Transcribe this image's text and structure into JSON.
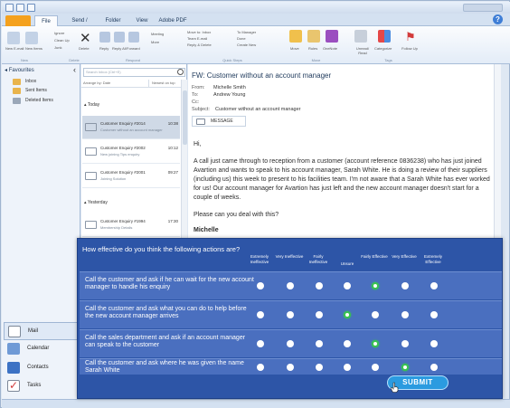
{
  "ribbon": {
    "tabs": [
      "File",
      "Send / Receive",
      "Folder",
      "View",
      "Adobe PDF"
    ],
    "groups": [
      "New",
      "Delete",
      "Respond",
      "Quick Steps",
      "Move",
      "Tags"
    ],
    "buttons": {
      "new_email": "New E-mail",
      "new_items": "New Items",
      "ignore": "Ignore",
      "clean_up": "Clean Up",
      "junk": "Junk",
      "delete": "Delete",
      "reply": "Reply",
      "reply_all": "Reply All",
      "forward": "Forward",
      "meeting": "Meeting",
      "more": "More",
      "move_to_inbox": "Move to: Inbox",
      "team_email": "Team E-mail",
      "reply_delete": "Reply & Delete",
      "to_manager": "To Manager",
      "done": "Done",
      "create_new": "Create New",
      "move": "Move",
      "rules": "Rules",
      "onenote": "OneNote",
      "unread_read": "Unread/ Read",
      "categorize": "Categorize",
      "follow_up": "Follow Up"
    }
  },
  "nav": {
    "header": "Favourites",
    "folders": [
      "Inbox",
      "Sent Items",
      "Deleted Items"
    ],
    "buttons": [
      "Mail",
      "Calendar",
      "Contacts",
      "Tasks"
    ]
  },
  "list": {
    "search_placeholder": "Search Inbox (Ctrl+E)",
    "arrange_by": "Arrange by: Date",
    "arrange_order": "Newest on top",
    "groups": [
      "Today",
      "Yesterday"
    ],
    "messages_today": [
      {
        "subject": "Customer Enquiry #2014",
        "preview": "Customer without an account manager",
        "time": "10:38"
      },
      {
        "subject": "Customer Enquiry #2002",
        "preview": "New joining Tips enquiry",
        "time": "10:12"
      },
      {
        "subject": "Customer Enquiry #2001",
        "preview": "Joining Solution",
        "time": "09:27"
      }
    ],
    "messages_yesterday": [
      {
        "subject": "Customer Enquiry #1994",
        "preview": "Membership Details",
        "time": "17:30"
      }
    ]
  },
  "reading": {
    "subject": "FW: Customer without an account manager",
    "from_label": "From:",
    "from": "Michelle Smith",
    "to_label": "To:",
    "to": "Andrew Young",
    "cc_label": "Cc:",
    "cc": "",
    "subject_label": "Subject:",
    "subject_value": "Customer without an account manager",
    "message_tab": "MESSAGE",
    "greeting": "Hi,",
    "body_lines": [
      "A call  just came through to reception from a customer (account reference 0836238) who has just joined",
      "Avartion and wants to speak to his account manager, Sarah White. He is doing a review of their suppliers",
      "(including us) this week to present to his facilities team.  I'm not aware that a Sarah White has ever worked",
      "for us! Our account manager for Avartion has just left and the new account manager doesn't start for a",
      "couple of weeks."
    ],
    "closing": "Please can you deal with this?",
    "signature": "Michelle"
  },
  "survey": {
    "question": "How effective do you think the following actions are?",
    "columns": [
      "Extremely Ineffective",
      "Very Ineffective",
      "Fairly Ineffective",
      "Unsure",
      "Fairly Effective",
      "Very Effective",
      "Extremely Effective"
    ],
    "rows": [
      {
        "text": "Call the customer and ask if he can wait for the new account manager to handle his enquiry",
        "selected": 4
      },
      {
        "text": "Call the customer and ask what you can do to help before the new account manager arrives",
        "selected": 3
      },
      {
        "text": "Call the sales department and ask if an account manager can speak to the customer",
        "selected": 4
      },
      {
        "text": "Call the customer and ask where he was given the name Sarah White",
        "selected": 5
      }
    ],
    "submit_label": "SUBMIT",
    "accent_color": "#38c44f",
    "panel_color": "#2d55a7"
  }
}
